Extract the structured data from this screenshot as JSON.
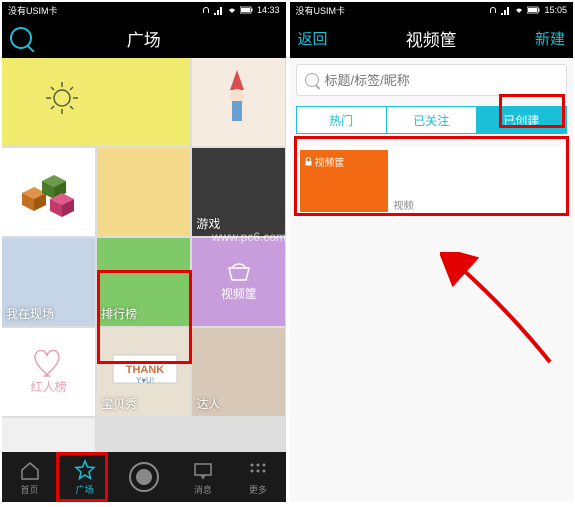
{
  "left": {
    "status": {
      "carrier": "没有USIM卡",
      "time": "14:33"
    },
    "header": {
      "title": "广场"
    },
    "tiles": {
      "game": "游戏",
      "scene": "我在现场",
      "rank": "排行榜",
      "video": "视频筐",
      "red": "红人榜",
      "thank": "宝贝秀",
      "person": "达人"
    },
    "nav": {
      "home": "首页",
      "plaza": "广场",
      "msg": "消息",
      "more": "更多"
    }
  },
  "right": {
    "status": {
      "carrier": "没有USIM卡",
      "time": "15:05"
    },
    "header": {
      "back": "返回",
      "title": "视频筐",
      "new": "新建"
    },
    "search": {
      "placeholder": "标题/标签/昵称"
    },
    "tabs": {
      "hot": "热门",
      "follow": "已关注",
      "created": "已创建"
    },
    "item": {
      "title": "视频筐",
      "meta": "视频"
    }
  },
  "watermark": "www.pc6.com"
}
